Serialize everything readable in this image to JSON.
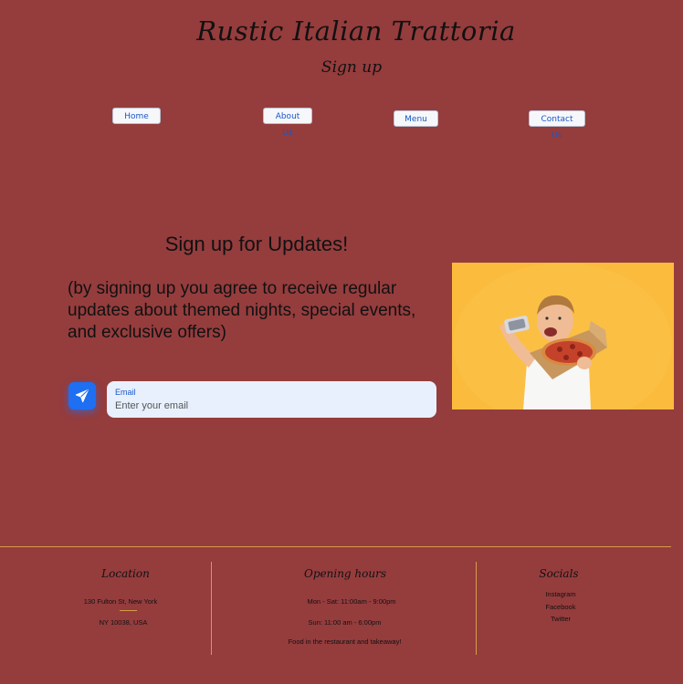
{
  "header": {
    "title": "Rustic Italian Trattoria",
    "subtitle": "Sign up"
  },
  "nav": {
    "home": "Home",
    "about": "About Us",
    "menu": "Menu",
    "contact": "Contact Us"
  },
  "signup": {
    "heading": "Sign up for Updates!",
    "description": "(by signing up you agree to receive regular updates about themed nights, special events, and exclusive offers)",
    "email_label": "Email",
    "email_placeholder": "Enter your email",
    "send_icon": "paper-plane-icon"
  },
  "image": {
    "subject": "boy taking a selfie with a pizza",
    "background_color": "#fbbb3c"
  },
  "footer": {
    "location": {
      "title": "Location",
      "line1": "130 Fulton St,  New York",
      "line2": "NY 10038, USA"
    },
    "hours": {
      "title": "Opening hours",
      "line1": "Mon - Sat: 11:00am - 9:00pm",
      "line2": "Sun: 11:00 am - 6:00pm",
      "line3": "Food in the restaurant and takeaway!"
    },
    "socials": {
      "title": "Socials",
      "links": [
        "Instagram",
        "Facebook",
        "Twitter"
      ]
    }
  },
  "colors": {
    "background": "#953c3d",
    "accent": "#1e6ff2",
    "divider": "#d69c4c"
  }
}
